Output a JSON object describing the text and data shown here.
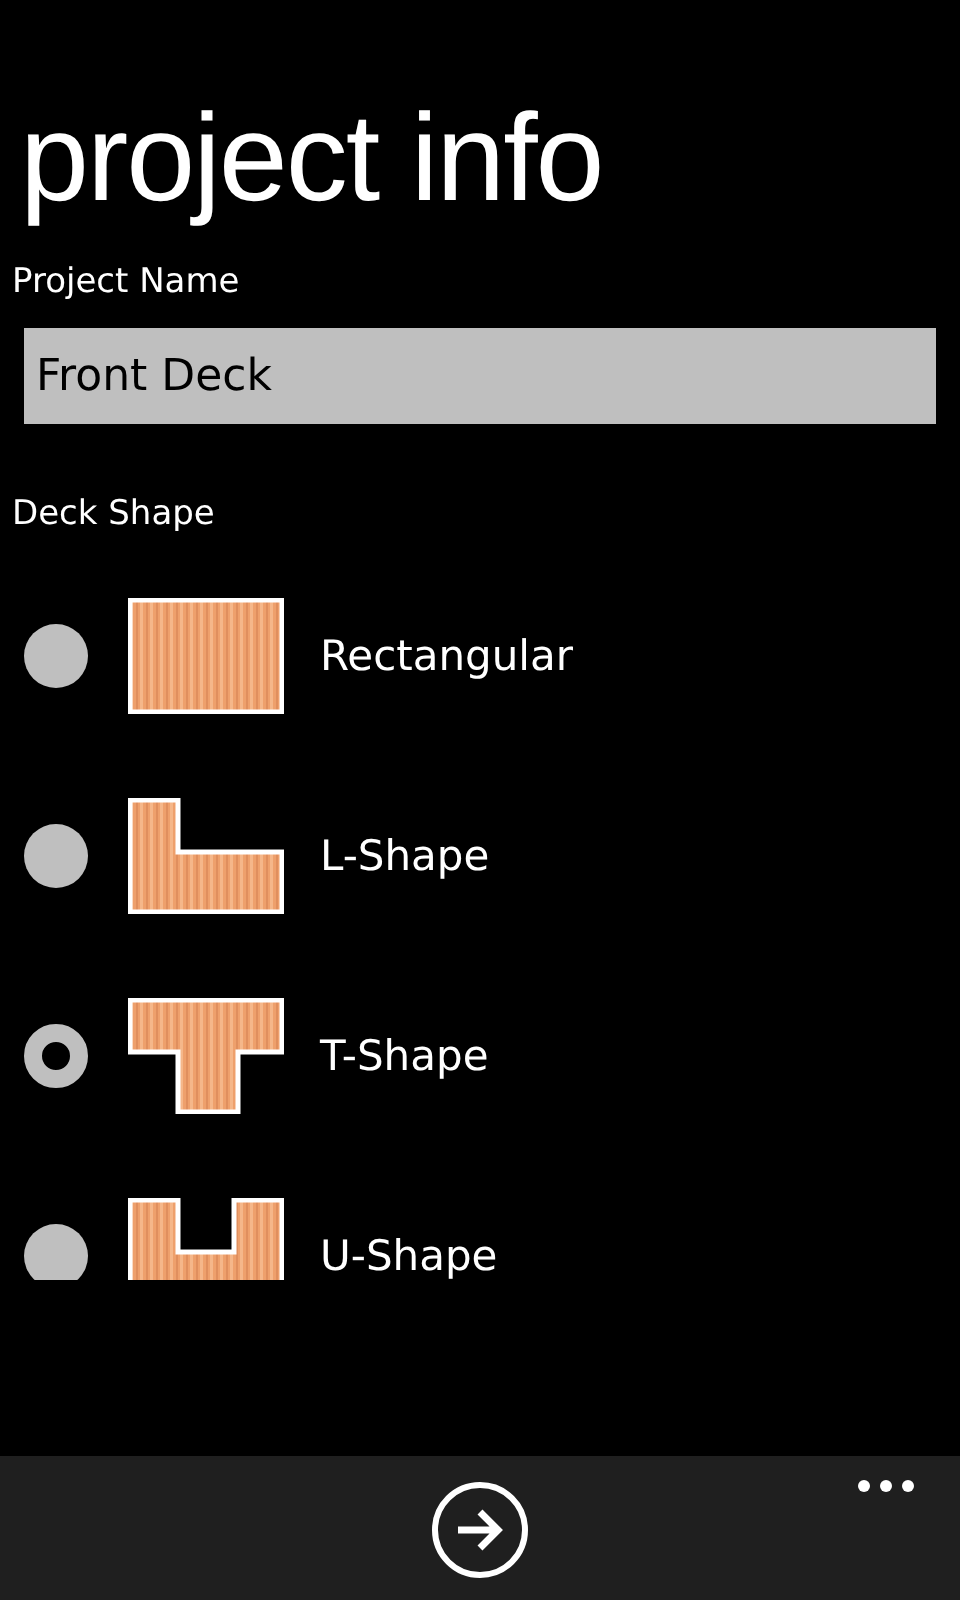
{
  "page_title": "project info",
  "project_name": {
    "label": "Project Name",
    "value": "Front Deck"
  },
  "deck_shape": {
    "label": "Deck Shape",
    "options": [
      {
        "label": "Rectangular",
        "kind": "rectangle",
        "selected": false
      },
      {
        "label": "L-Shape",
        "kind": "l",
        "selected": false
      },
      {
        "label": "T-Shape",
        "kind": "t",
        "selected": true
      },
      {
        "label": "U-Shape",
        "kind": "u",
        "selected": false
      }
    ]
  }
}
